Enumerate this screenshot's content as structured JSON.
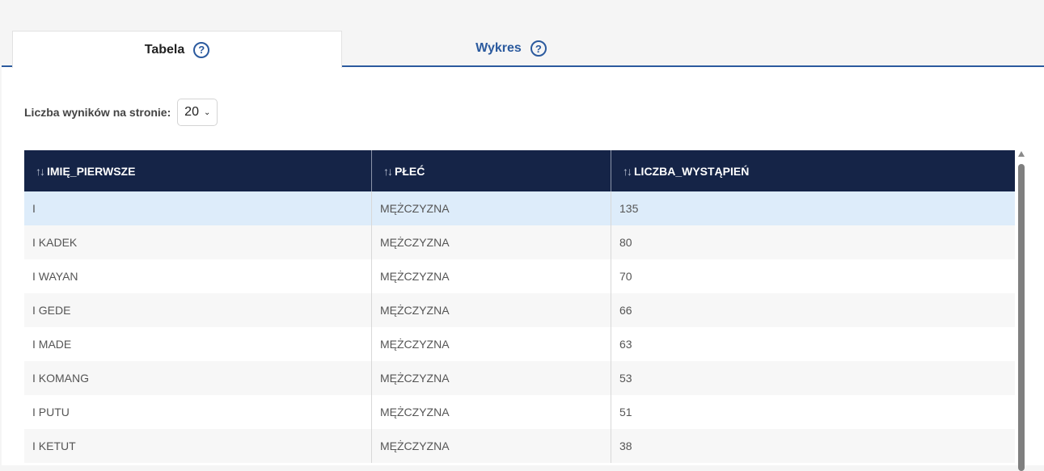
{
  "tabs": [
    {
      "label": "Tabela",
      "active": true
    },
    {
      "label": "Wykres",
      "active": false
    }
  ],
  "pagination": {
    "label": "Liczba wyników na stronie:",
    "value": "20"
  },
  "table": {
    "columns": [
      "IMIĘ_PIERWSZE",
      "PŁEĆ",
      "LICZBA_WYSTĄPIEŃ"
    ],
    "rows": [
      [
        "I",
        "MĘŻCZYZNA",
        "135"
      ],
      [
        "I KADEK",
        "MĘŻCZYZNA",
        "80"
      ],
      [
        "I WAYAN",
        "MĘŻCZYZNA",
        "70"
      ],
      [
        "I GEDE",
        "MĘŻCZYZNA",
        "66"
      ],
      [
        "I MADE",
        "MĘŻCZYZNA",
        "63"
      ],
      [
        "I KOMANG",
        "MĘŻCZYZNA",
        "53"
      ],
      [
        "I PUTU",
        "MĘŻCZYZNA",
        "51"
      ],
      [
        "I KETUT",
        "MĘŻCZYZNA",
        "38"
      ]
    ]
  },
  "colors": {
    "accent": "#2b5a9e",
    "header_bg": "#152447",
    "selected_row": "#ddecfa"
  }
}
